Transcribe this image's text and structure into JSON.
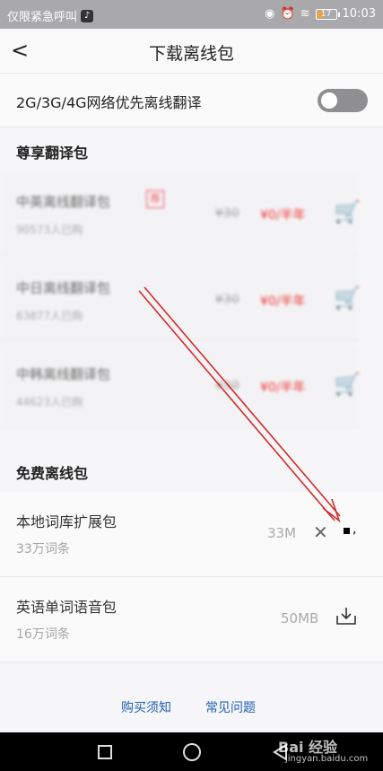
{
  "status_bar": {
    "left_text": "仅限紧急呼叫",
    "battery_level": "17",
    "time": "10:03"
  },
  "header": {
    "back_glyph": "<",
    "title": "下载离线包"
  },
  "network_setting": {
    "label": "2G/3G/4G网络优先离线翻译",
    "enabled": false
  },
  "premium_section": {
    "title": "尊享翻译包",
    "items": [
      {
        "name": "中英离线翻译包",
        "count": "90573人已购",
        "tag": "荐",
        "original_price": "¥30",
        "price": "¥0/半年"
      },
      {
        "name": "中日离线翻译包",
        "count": "63877人已购",
        "original_price": "¥30",
        "price": "¥0/半年"
      },
      {
        "name": "中韩离线翻译包",
        "count": "44623人已购",
        "original_price": "¥30",
        "price": "¥0/半年"
      }
    ]
  },
  "free_section": {
    "title": "免费离线包",
    "items": [
      {
        "name": "本地词库扩展包",
        "count": "33万词条",
        "size": "33M"
      },
      {
        "name": "英语单词语音包",
        "count": "16万词条",
        "size": "50MB"
      }
    ]
  },
  "footer": {
    "purchase_notice": "购买须知",
    "faq": "常见问题"
  },
  "watermark": {
    "brand": "Bai 经验",
    "url": "jingyan.baidu.com"
  },
  "colors": {
    "link": "#1f5fb4",
    "price_red": "#e33333",
    "annotation_arrow": "#d42a2a"
  }
}
